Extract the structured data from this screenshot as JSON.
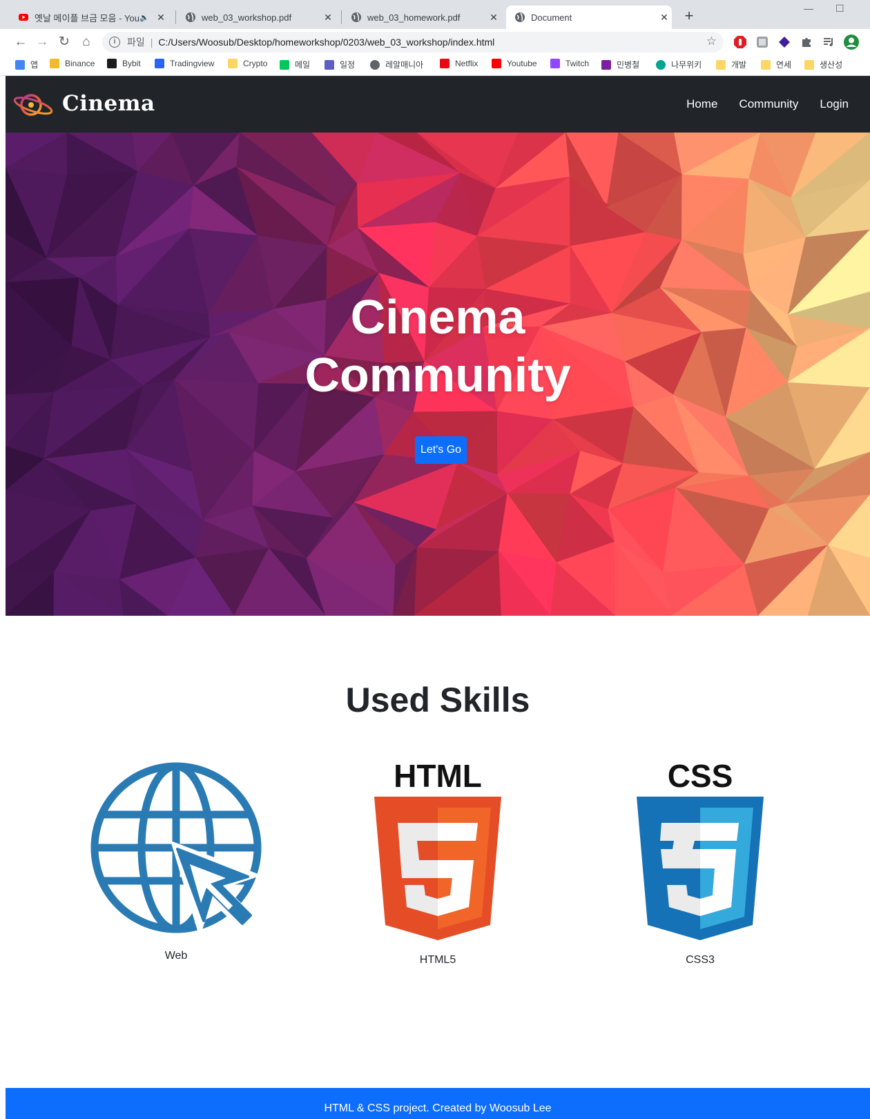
{
  "browser": {
    "tabs": [
      {
        "title": "옛날 메이플 브금 모음 - YouTube",
        "favicon": "youtube-icon",
        "active": false
      },
      {
        "title": "web_03_workshop.pdf",
        "favicon": "globe-icon",
        "active": false
      },
      {
        "title": "web_03_homework.pdf",
        "favicon": "globe-icon",
        "active": false
      },
      {
        "title": "Document",
        "favicon": "globe-icon",
        "active": true
      }
    ],
    "address": {
      "scheme_label": "파일",
      "url": "C:/Users/Woosub/Desktop/homeworkshop/0203/web_03_workshop/index.html"
    },
    "bookmarks": [
      {
        "label": "앱",
        "icon": "apps-grid-icon"
      },
      {
        "label": "Binance",
        "icon": "binance-icon"
      },
      {
        "label": "Bybit",
        "icon": "bybit-icon"
      },
      {
        "label": "Tradingview",
        "icon": "tradingview-icon"
      },
      {
        "label": "Crypto",
        "icon": "folder-icon"
      },
      {
        "label": "메일",
        "icon": "mail-icon"
      },
      {
        "label": "일정",
        "icon": "calendar-icon"
      },
      {
        "label": "레알매니아",
        "icon": "globe-icon"
      },
      {
        "label": "Netflix",
        "icon": "netflix-icon"
      },
      {
        "label": "Youtube",
        "icon": "youtube-icon"
      },
      {
        "label": "Twitch",
        "icon": "twitch-icon"
      },
      {
        "label": "민병철",
        "icon": "site-icon"
      },
      {
        "label": "나무위키",
        "icon": "namuwiki-icon"
      },
      {
        "label": "개발",
        "icon": "folder-icon"
      },
      {
        "label": "연세",
        "icon": "folder-icon"
      },
      {
        "label": "생산성",
        "icon": "folder-icon"
      }
    ]
  },
  "site": {
    "brand": "Cinema",
    "nav": [
      "Home",
      "Community",
      "Login"
    ],
    "hero": {
      "title_line1": "Cinema",
      "title_line2": "Community",
      "button": "Let's Go"
    },
    "skills": {
      "title": "Used Skills",
      "items": [
        {
          "label": "Web",
          "icon": "web-globe-cursor-icon"
        },
        {
          "label": "HTML5",
          "icon": "html5-logo-icon",
          "logo_text": "HTML"
        },
        {
          "label": "CSS3",
          "icon": "css3-logo-icon",
          "logo_text": "CSS"
        }
      ]
    },
    "footer": "HTML & CSS project. Created by Woosub Lee"
  },
  "colors": {
    "navbar": "#212529",
    "primary": "#0d6efd",
    "web_icon": "#2a7bb4",
    "html5_orange": "#e44d26",
    "html5_light": "#f16529",
    "css3_blue": "#1572b6",
    "css3_light": "#33a9dc"
  }
}
